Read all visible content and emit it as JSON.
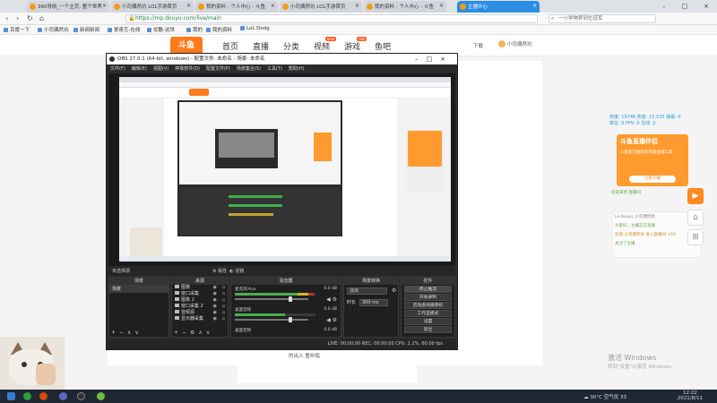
{
  "browser": {
    "tabs": [
      {
        "label": "360导航_一个主页, 整个世界",
        "active": false
      },
      {
        "label": "小司偶然坑 LOL手游首页",
        "active": false
      },
      {
        "label": "我的资料 - 个人中心 - 斗鱼",
        "active": false
      },
      {
        "label": "小司偶然坑 LOL手游首页",
        "active": false
      },
      {
        "label": "我的资料 - 个人中心 - 斗鱼",
        "active": false
      },
      {
        "label": "主播中心",
        "active": true
      }
    ],
    "url": "https://mp.douyu.com/live/main",
    "search_placeholder": "一小学物养到位冠军",
    "bookmarks": [
      "百度一下",
      "小司偶然坑",
      "新闻新闻",
      "爱奇艺-在线",
      "优酷-这世",
      "我的",
      "我的资料",
      "LoL Dodg"
    ]
  },
  "site": {
    "logo": "斗鱼",
    "nav": [
      {
        "label": "首页",
        "badge": ""
      },
      {
        "label": "直播",
        "badge": ""
      },
      {
        "label": "分类",
        "badge": ""
      },
      {
        "label": "视频",
        "badge": "new"
      },
      {
        "label": "游戏",
        "badge": "hot"
      },
      {
        "label": "鱼吧",
        "badge": ""
      }
    ],
    "download": "下载",
    "username": "小司偶然坑",
    "footer": "的出入 重听唱"
  },
  "chat": {
    "stats_line1": "热度: 19746  热度: 15,535  弹幕: 0",
    "stats_line2": "禁言: 0  FPS: 0  在线: 0",
    "banner_title": "斗鱼直播伴侣",
    "banner_desc": "斗鱼官方推荐的优质直播工具",
    "banner_button": "立即下载",
    "lines": [
      "欢迎来到 直播间",
      "Lv.douyu_小司偶然坑",
      "大家好，主播正在直播",
      "欢迎 小司偶然坑 进入直播间 +50",
      "关注了主播"
    ]
  },
  "obs": {
    "title": "OBS 27.0.1 (64-bit, windows) - 配置文件: 未命名 - 场景: 未命名",
    "menu": [
      "文件(F)",
      "编辑(E)",
      "视图(V)",
      "停靠部件(D)",
      "配置文件(P)",
      "场景集合(S)",
      "工具(T)",
      "帮助(H)"
    ],
    "no_source": "未选择源",
    "props_label": "属性",
    "filters_label": "滤镜",
    "panels": {
      "scenes": "场景",
      "sources": "来源",
      "mixer": "混音器",
      "transitions": "场景转换",
      "controls": "控件"
    },
    "scene_items": [
      "场景"
    ],
    "source_items": [
      "图像",
      "窗口采集",
      "图像 2",
      "窗口采集 2",
      "音频源",
      "显示器采集"
    ],
    "mixer": [
      {
        "name": "麦克风/Aux",
        "db": "0.0 dB"
      },
      {
        "name": "桌面音频",
        "db": "0.0 dB"
      },
      {
        "name": "桌面音频",
        "db": "0.0 dB"
      }
    ],
    "transition": "淡出",
    "duration_label": "时长",
    "duration": "300 ms",
    "controls": [
      "停止推流",
      "开始录制",
      "启动虚拟摄像机",
      "工作室模式",
      "设置",
      "退出"
    ],
    "status": "LIVE: 00:00:00   REC: 00:00:00   CPU: 1.1%, 60.00 fps"
  },
  "windows": {
    "watermark_title": "激活 Windows",
    "watermark_sub": "转到\"设置\"以激活 Windows。",
    "weather": "30°C 空气优 33",
    "time": "12:22",
    "date": "2021/8/11"
  }
}
